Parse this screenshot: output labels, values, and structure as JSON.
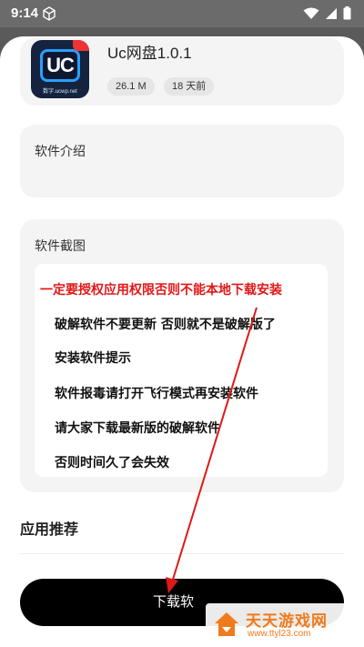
{
  "status_bar": {
    "time": "9:14",
    "icons": [
      "cube-icon",
      "wifi-icon",
      "signal-icon",
      "battery-icon"
    ]
  },
  "app": {
    "name": "Uc网盘1.0.1",
    "size": "26.1 M",
    "updated": "18 天前",
    "icon_text": "UC",
    "icon_site": "数字.ucwp.net"
  },
  "sections": {
    "intro_label": "软件介绍",
    "screenshots_label": "软件截图",
    "recommend_label": "应用推荐"
  },
  "notice": {
    "warning": "一定要授权应用权限否则不能本地下载安装",
    "lines": [
      "破解软件不要更新 否则就不是破解版了",
      "安装软件提示",
      "软件报毒请打开飞行模式再安装软件",
      "请大家下载最新版的破解软件",
      "否则时间久了会失效"
    ]
  },
  "download_label": "下载软",
  "watermark": {
    "title": "天天游戏网",
    "url": "www.ttyl23.com"
  },
  "colors": {
    "warning": "#e01818",
    "accent": "#f07a1c",
    "button": "#000000",
    "annotation_arrow": "#e01818"
  }
}
